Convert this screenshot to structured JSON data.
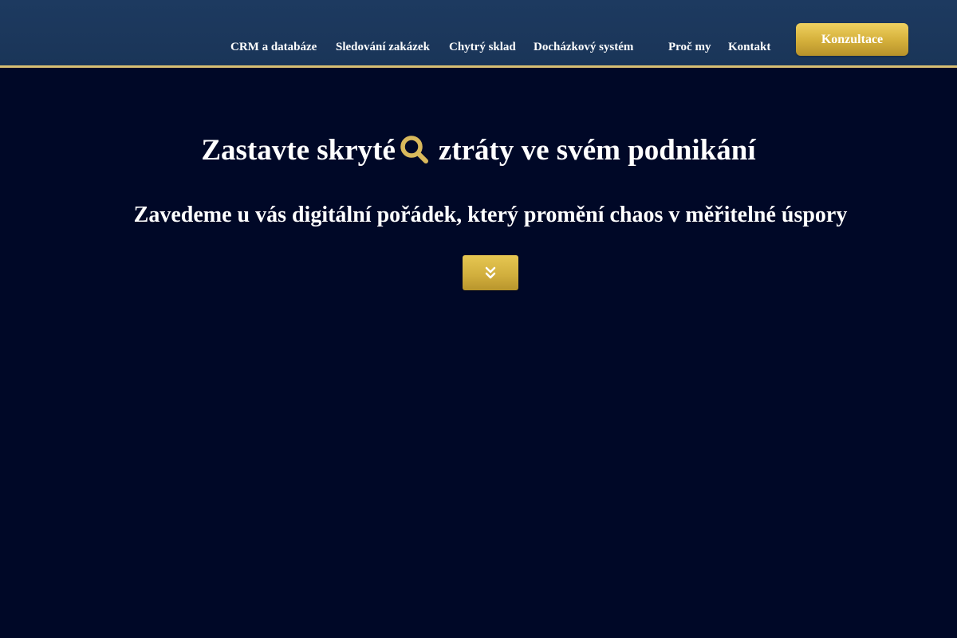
{
  "header": {
    "nav": [
      {
        "label": "CRM a databáze"
      },
      {
        "label": "Sledování zakázek"
      },
      {
        "label": "Chytrý sklad"
      },
      {
        "label": "Docházkový systém"
      },
      {
        "label": "Proč my"
      },
      {
        "label": "Kontakt"
      }
    ],
    "cta_label": "Konzultace"
  },
  "hero": {
    "title_before_icon": "Zastavte skryté",
    "title_after_icon": "ztráty ve svém podnikání",
    "title_icon": "search-icon",
    "subtitle": "Zavedeme u vás digitální pořádek, který promění chaos v měřitelné úspory",
    "scroll_icon": "double-chevron-down-icon"
  },
  "colors": {
    "header_bg": "#1d3a60",
    "page_bg": "#000827",
    "accent_gold": "#d6b23d",
    "header_border": "#d8bf73",
    "text": "#ffffff"
  }
}
